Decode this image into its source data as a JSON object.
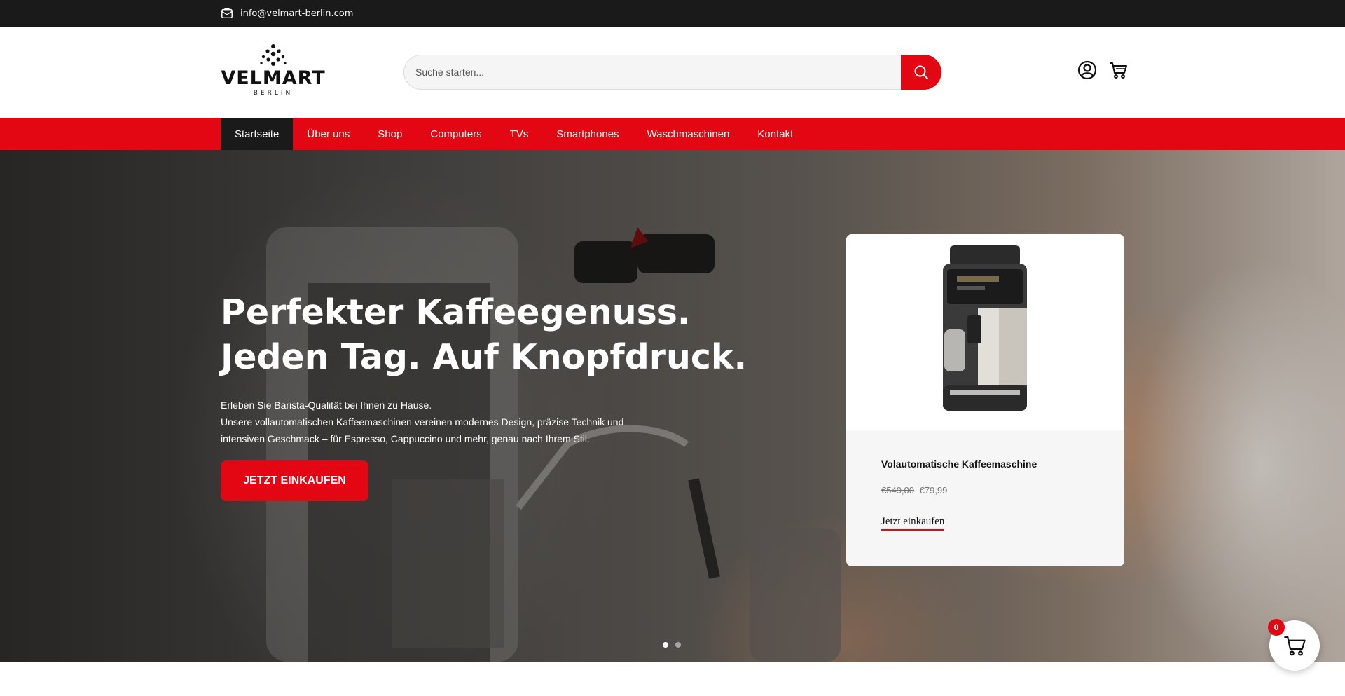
{
  "topbar": {
    "email": "info@velmart-berlin.com",
    "icon": "envelope-icon"
  },
  "header": {
    "logo": {
      "name": "VELMART",
      "subtitle": "BERLIN"
    },
    "search": {
      "placeholder": "Suche starten...",
      "icon": "search-icon"
    },
    "icons": [
      "user-account-icon",
      "cart-icon"
    ]
  },
  "nav": {
    "items": [
      {
        "label": "Startseite",
        "active": true
      },
      {
        "label": "Über uns"
      },
      {
        "label": "Shop"
      },
      {
        "label": "Computers"
      },
      {
        "label": "TVs"
      },
      {
        "label": "Smartphones"
      },
      {
        "label": "Waschmaschinen"
      },
      {
        "label": "Kontakt"
      }
    ]
  },
  "hero": {
    "headline": "Perfekter Kaffeegenuss. Jeden Tag. Auf Knopfdruck.",
    "description_line1": "Erleben Sie Barista-Qualität bei Ihnen zu Hause.",
    "description_line2": "Unsere vollautomatischen Kaffeemaschinen vereinen modernes Design, präzise Technik und intensiven Geschmack – für Espresso, Cappuccino und mehr, genau nach Ihrem Stil.",
    "cta": "JETZT EINKAUFEN",
    "slides": 2,
    "active_slide": 1
  },
  "product_card": {
    "title": "Volautomatische Kaffeemaschine",
    "old_price": "€549,00",
    "new_price": "€79,99",
    "link": "Jetzt einkaufen"
  },
  "floating_cart": {
    "count": "0",
    "icon": "cart-icon"
  },
  "colors": {
    "brand_red": "#e30613",
    "dark": "#1a1a1a"
  }
}
